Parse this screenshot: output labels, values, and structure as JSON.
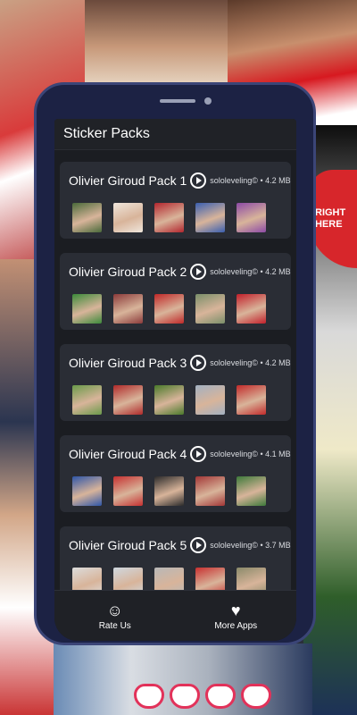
{
  "app": {
    "title": "Sticker Packs"
  },
  "background": {
    "heart_text": "RIGHT HERE"
  },
  "packs": [
    {
      "name": "Olivier Giroud Pack 1",
      "author": "sololeveling©",
      "size": "4.2 MB",
      "thumbs": [
        "#4a6a3a",
        "#efe6dc",
        "#b3262e",
        "#3a5fb0",
        "#8d4aa6"
      ]
    },
    {
      "name": "Olivier Giroud Pack 2",
      "author": "sololeveling©",
      "size": "4.2 MB",
      "thumbs": [
        "#3c8a3a",
        "#8b3a3a",
        "#c02828",
        "#7a8f6a",
        "#c21f2a"
      ]
    },
    {
      "name": "Olivier Giroud Pack 3",
      "author": "sololeveling©",
      "size": "4.2 MB",
      "thumbs": [
        "#6a9a4a",
        "#b02a2a",
        "#4a7a2a",
        "#a3b1c2",
        "#c22a2a"
      ]
    },
    {
      "name": "Olivier Giroud Pack 4",
      "author": "sololeveling©",
      "size": "4.1 MB",
      "thumbs": [
        "#2f56a8",
        "#c63030",
        "#2b2b2b",
        "#a33636",
        "#3d7a3a"
      ]
    },
    {
      "name": "Olivier Giroud Pack 5",
      "author": "sololeveling©",
      "size": "3.7 MB",
      "thumbs": [
        "#dcdcdc",
        "#cfd8e0",
        "#b8b8b8",
        "#c83030",
        "#8a8a6a"
      ]
    }
  ],
  "nav": {
    "rate_label": "Rate Us",
    "rate_icon": "smiley-icon",
    "more_label": "More Apps",
    "more_icon": "heart-icon"
  }
}
